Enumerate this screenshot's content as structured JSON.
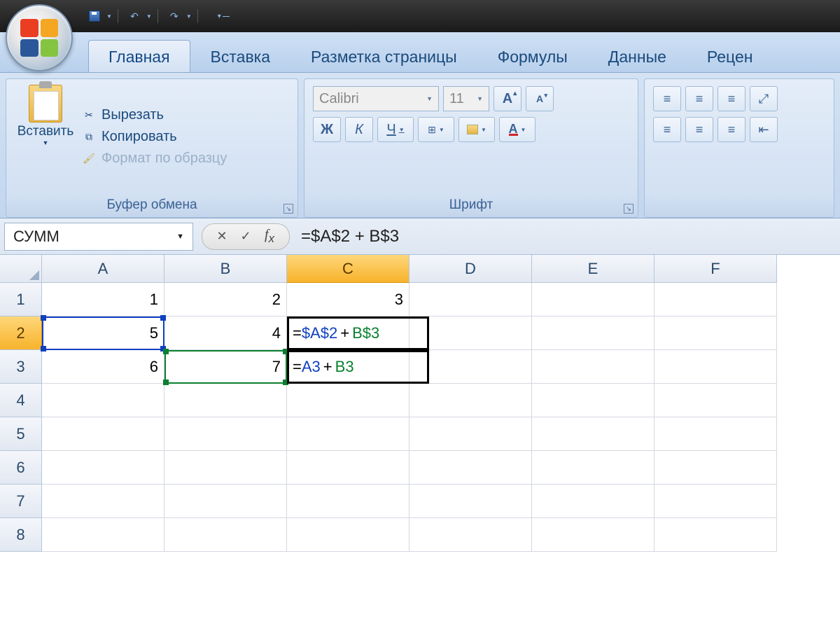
{
  "qat": {
    "save": "save",
    "undo": "undo",
    "redo": "redo"
  },
  "tabs": {
    "home": "Главная",
    "insert": "Вставка",
    "layout": "Разметка страницы",
    "formulas": "Формулы",
    "data": "Данные",
    "review": "Рецен"
  },
  "ribbon": {
    "clipboard": {
      "paste": "Вставить",
      "cut": "Вырезать",
      "copy": "Копировать",
      "format_painter": "Формат по образцу",
      "group_label": "Буфер обмена"
    },
    "font": {
      "name": "Calibri",
      "size": "11",
      "bold": "Ж",
      "italic": "К",
      "underline": "Ч",
      "group_label": "Шрифт"
    }
  },
  "formula_bar": {
    "name_box": "СУММ",
    "formula": "=$A$2 + B$3"
  },
  "grid": {
    "cols": [
      "A",
      "B",
      "C",
      "D",
      "E",
      "F"
    ],
    "rows": [
      "1",
      "2",
      "3",
      "4",
      "5",
      "6",
      "7",
      "8"
    ],
    "active_col": "C",
    "active_row": "2",
    "data": {
      "A1": "1",
      "B1": "2",
      "C1": "3",
      "A2": "5",
      "B2": "4",
      "A3": "6",
      "B3": "7"
    },
    "c2_formula": {
      "eq": "=",
      "ref1": "$A$2",
      "plus": " + ",
      "ref2": "B$3"
    },
    "c3_formula": {
      "eq": "= ",
      "ref1": "A3",
      "plus": " + ",
      "ref2": "B3"
    }
  }
}
